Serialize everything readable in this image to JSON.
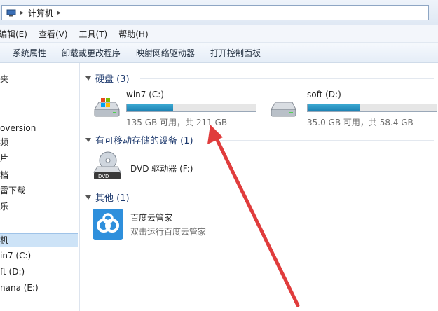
{
  "address": {
    "separator1": "▸",
    "location": "计算机",
    "separator2": "▸"
  },
  "menu": [
    "编辑(E)",
    "查看(V)",
    "工具(T)",
    "帮助(H)"
  ],
  "toolbar": [
    "系统属性",
    "卸载或更改程序",
    "映射网络驱动器",
    "打开控制面板"
  ],
  "nav": {
    "items": [
      "夹",
      "",
      "",
      "oversion",
      "频",
      "片",
      "档",
      "雷下载",
      "乐",
      "",
      "机",
      "in7 (C:)",
      "ft (D:)",
      "nana (E:)"
    ]
  },
  "groups": {
    "hdd": "硬盘 (3)",
    "removable": "有可移动存储的设备 (1)",
    "other": "其他 (1)"
  },
  "drives": [
    {
      "name": "win7 (C:)",
      "free": "135 GB 可用，共 211 GB",
      "used_fraction": 0.36,
      "icon": "windows-drive-icon"
    },
    {
      "name": "soft (D:)",
      "free": "35.0 GB 可用，共 58.4 GB",
      "used_fraction": 0.4,
      "icon": "hard-drive-icon"
    }
  ],
  "dvd": {
    "name": "DVD 驱动器 (F:)",
    "icon_label": "DVD"
  },
  "app": {
    "title": "百度云管家",
    "subtitle": "双击运行百度云管家",
    "icon": "baidu-cloud-icon"
  },
  "colors": {
    "bar_fill": "#1f87b8",
    "selection": "#cde3f7",
    "arrow": "#e03c3c",
    "group_text": "#1e3a6e"
  }
}
